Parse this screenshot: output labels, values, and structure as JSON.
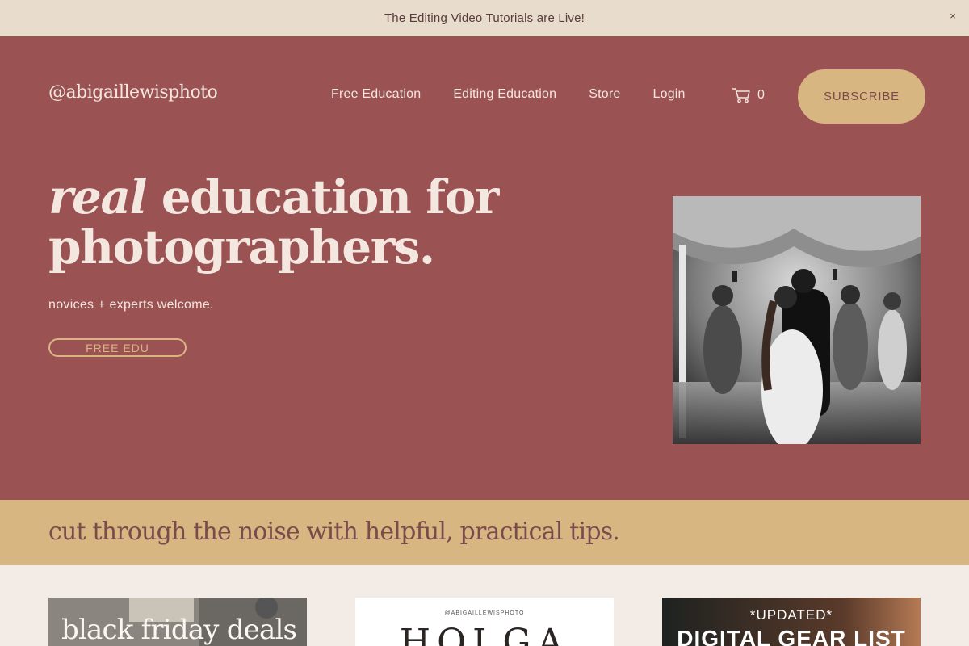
{
  "announcement": {
    "text": "The Editing Video Tutorials are Live!",
    "close": "×"
  },
  "header": {
    "logo": "@abigaillewisphoto",
    "nav": [
      "Free Education",
      "Editing Education",
      "Store",
      "Login"
    ],
    "cart_count": "0",
    "subscribe": "SUBSCRIBE"
  },
  "hero": {
    "headline_italic": "real",
    "headline_rest": " education for photographers.",
    "subtitle": "novices + experts welcome.",
    "cta": "FREE EDU",
    "photo_icon": "wedding-dance-photo"
  },
  "tips": {
    "heading": "cut through the noise with helpful, practical tips."
  },
  "cards": {
    "card1_title": "black friday deals",
    "card2_small": "@ABIGAILLEWISPHOTO",
    "card2_big": "HOLGA",
    "card3_top": "*UPDATED*",
    "card3_title": "DIGITAL GEAR LIST"
  },
  "colors": {
    "hero_bg": "#9b5253",
    "gold": "#d8b682",
    "cream": "#f3e7df",
    "announce_bg": "#e8dccd"
  }
}
